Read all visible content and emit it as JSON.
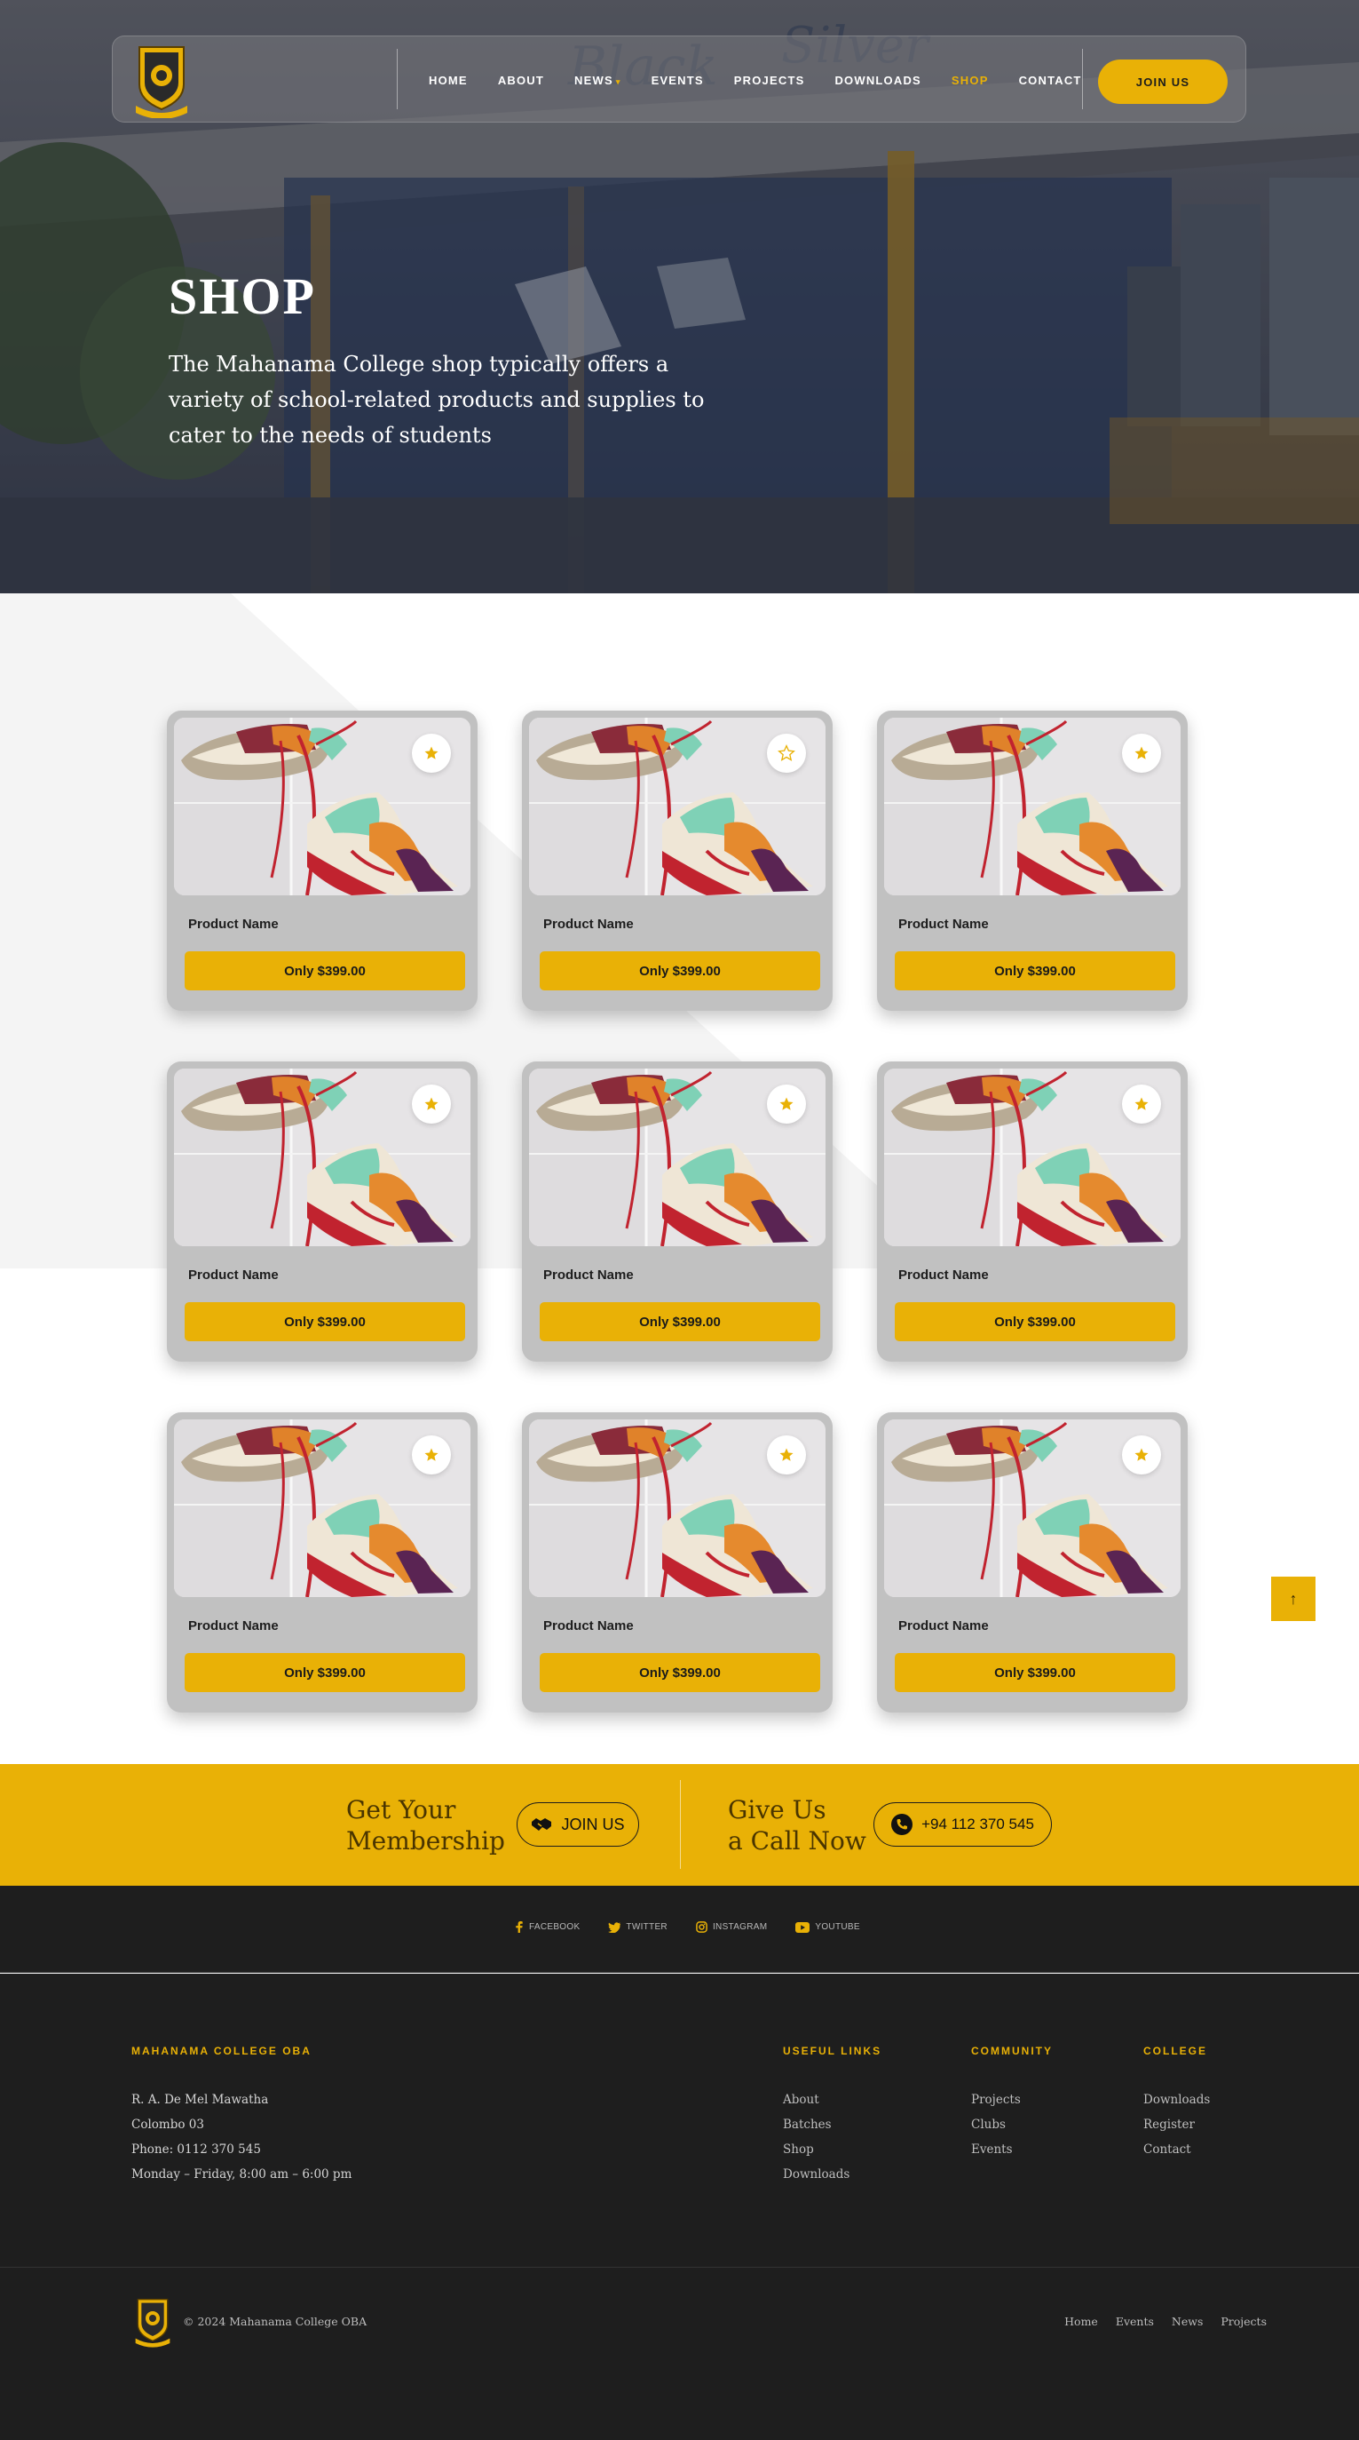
{
  "nav": {
    "links": [
      "HOME",
      "ABOUT",
      "NEWS",
      "EVENTS",
      "PROJECTS",
      "DOWNLOADS",
      "SHOP",
      "CONTACT"
    ],
    "active": "SHOP",
    "join_label": "JOIN US"
  },
  "hero": {
    "title": "SHOP",
    "text": "The Mahanama College shop typically offers a variety of school-related products and supplies to cater to the needs of students"
  },
  "products": [
    {
      "name": "Product Name",
      "price": "Only $399.00",
      "favorited": true
    },
    {
      "name": "Product Name",
      "price": "Only $399.00",
      "favorited": false
    },
    {
      "name": "Product Name",
      "price": "Only $399.00",
      "favorited": true
    },
    {
      "name": "Product Name",
      "price": "Only $399.00",
      "favorited": true
    },
    {
      "name": "Product Name",
      "price": "Only $399.00",
      "favorited": true
    },
    {
      "name": "Product Name",
      "price": "Only $399.00",
      "favorited": true
    },
    {
      "name": "Product Name",
      "price": "Only $399.00",
      "favorited": true
    },
    {
      "name": "Product Name",
      "price": "Only $399.00",
      "favorited": true
    },
    {
      "name": "Product Name",
      "price": "Only $399.00",
      "favorited": true
    }
  ],
  "scroll_top_icon": "arrow-up-icon",
  "cta": {
    "membership_line1": "Get Your",
    "membership_line2": "Membership",
    "join_label": "JOIN US",
    "call_line1": "Give Us",
    "call_line2": "a Call Now",
    "phone": "+94 112 370 545"
  },
  "social": [
    {
      "label": "FACEBOOK",
      "icon": "facebook-icon"
    },
    {
      "label": "TWITTER",
      "icon": "twitter-icon"
    },
    {
      "label": "INSTAGRAM",
      "icon": "instagram-icon"
    },
    {
      "label": "YOUTUBE",
      "icon": "youtube-icon"
    }
  ],
  "footer": {
    "org_title": "MAHANAMA COLLEGE OBA",
    "address1": "R. A. De Mel Mawatha",
    "address2": "Colombo 03",
    "phone": "Phone: 0112 370 545",
    "hours": "Monday – Friday, 8:00 am – 6:00 pm",
    "useful_title": "USEFUL LINKS",
    "useful": [
      "About",
      "Batches",
      "Shop",
      "Downloads"
    ],
    "community_title": "COMMUNITY",
    "community": [
      "Projects",
      "Clubs",
      "Events"
    ],
    "college_title": "COLLEGE",
    "college": [
      "Downloads",
      "Register",
      "Contact"
    ],
    "copyright": "© 2024 Mahanama College OBA",
    "bottom_links": [
      "Home",
      "Events",
      "News",
      "Projects"
    ]
  },
  "colors": {
    "accent": "#e9b106",
    "dark": "#1e1e1e",
    "card": "#c1c1c1"
  }
}
